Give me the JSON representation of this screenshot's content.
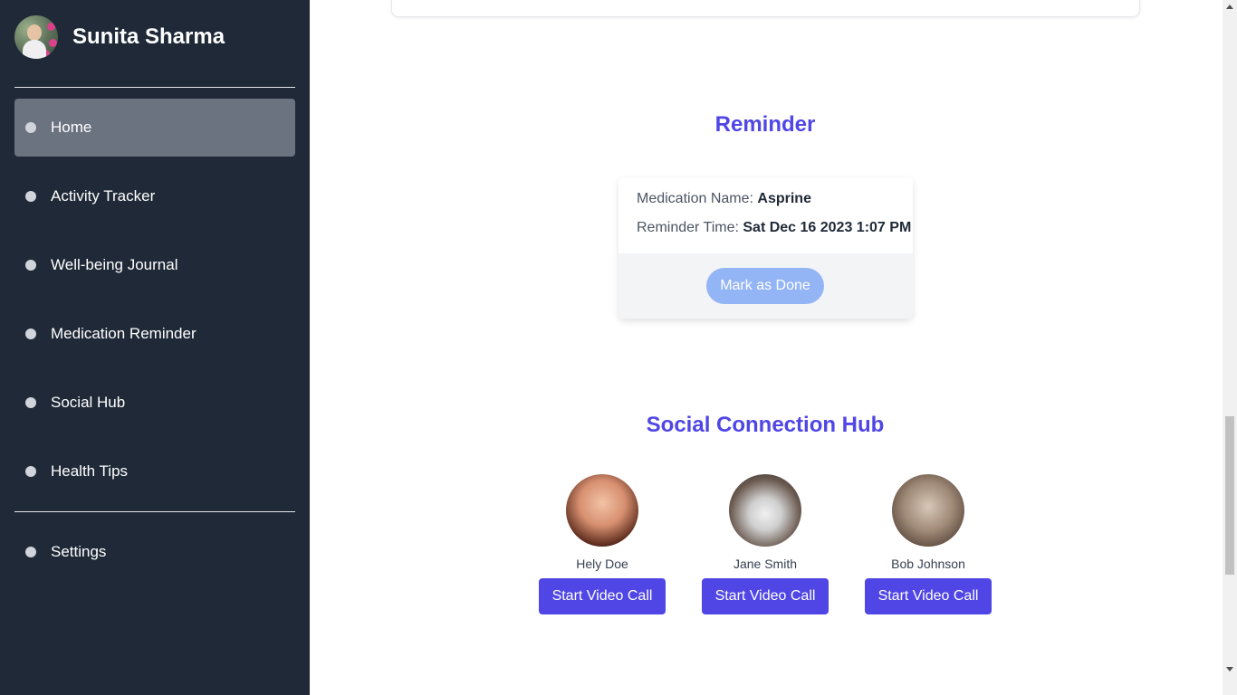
{
  "sidebar": {
    "user_name": "Sunita Sharma",
    "items": [
      {
        "label": "Home",
        "active": true
      },
      {
        "label": "Activity Tracker",
        "active": false
      },
      {
        "label": "Well-being Journal",
        "active": false
      },
      {
        "label": "Medication Reminder",
        "active": false
      },
      {
        "label": "Social Hub",
        "active": false
      },
      {
        "label": "Health Tips",
        "active": false
      }
    ],
    "settings_label": "Settings"
  },
  "reminder": {
    "title": "Reminder",
    "medication_label": "Medication Name:",
    "medication_value": "Asprine",
    "time_label": "Reminder Time:",
    "time_value": "Sat Dec 16 2023 1:07 PM",
    "done_button": "Mark as Done"
  },
  "social": {
    "title": "Social Connection Hub",
    "contacts": [
      {
        "name": "Hely Doe",
        "button": "Start Video Call"
      },
      {
        "name": "Jane Smith",
        "button": "Start Video Call"
      },
      {
        "name": "Bob Johnson",
        "button": "Start Video Call"
      }
    ]
  },
  "colors": {
    "sidebar_bg": "#1f2937",
    "active_item_bg": "#6b7280",
    "accent": "#4f46e5",
    "done_button_bg": "#93b4f5"
  }
}
